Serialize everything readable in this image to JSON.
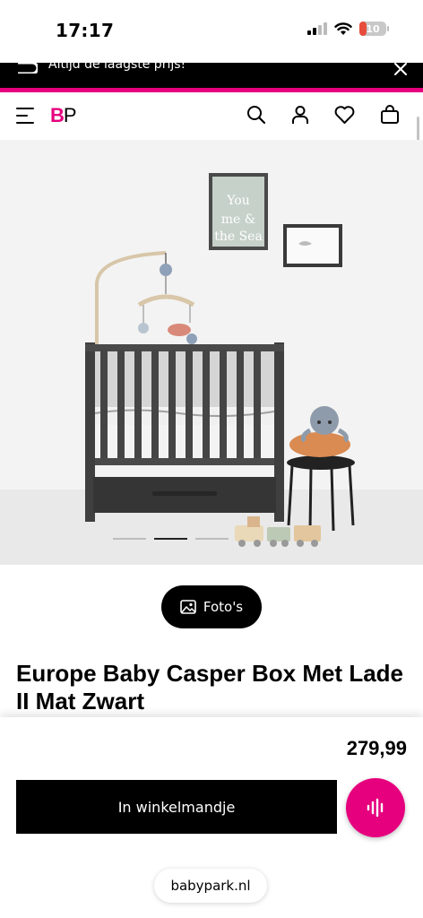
{
  "status_bar": {
    "time": "17:17",
    "battery": "10",
    "battery_level": 0.1,
    "battery_color": "#e74c3c"
  },
  "promo": {
    "text": "Altijd de laagste prijs!"
  },
  "header": {
    "logo_b": "B",
    "logo_p": "P",
    "icons": [
      "menu-icon",
      "search-icon",
      "account-icon",
      "heart-icon",
      "bag-icon"
    ]
  },
  "hero": {
    "wall_frame_text": [
      "You",
      "me &",
      "the Sea"
    ],
    "active_slide": 2,
    "slide_count": 3
  },
  "photos_button": {
    "label": "Foto's"
  },
  "product": {
    "title": "Europe Baby Casper Box Met Lade II Mat Zwart",
    "price": "279,99"
  },
  "cart_button": {
    "label": "In winkelmandje"
  },
  "browser": {
    "url": "babypark.nl"
  },
  "colors": {
    "brand": "#e6007e",
    "dark": "#000000"
  }
}
